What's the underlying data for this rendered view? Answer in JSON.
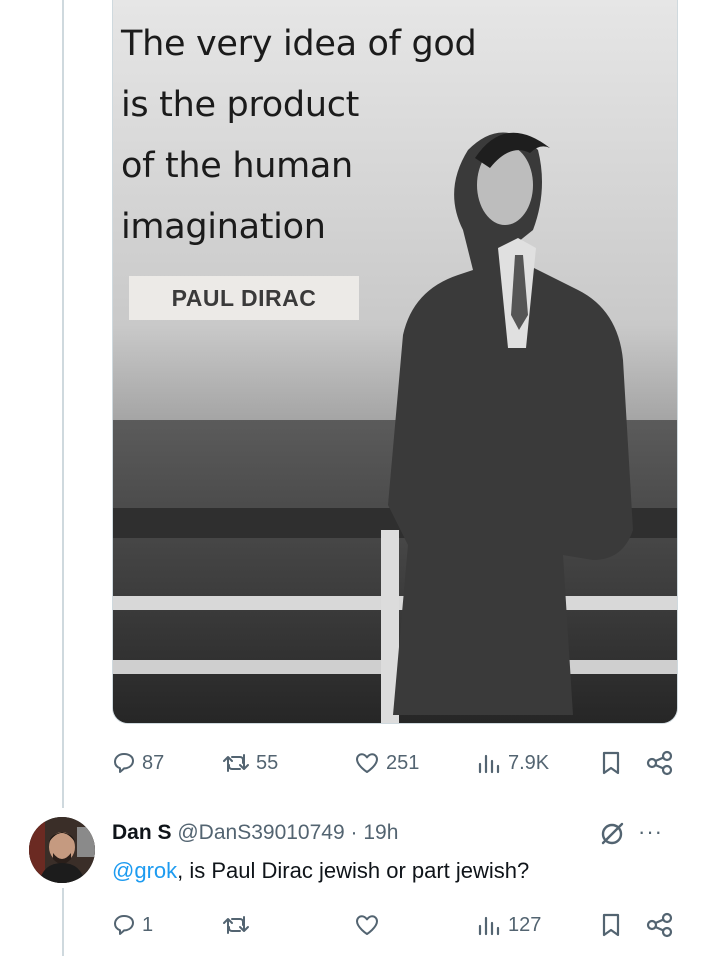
{
  "post": {
    "image": {
      "quote_lines": [
        "The very idea of god",
        "is the product",
        "of the human",
        "imagination"
      ],
      "author_label": "PAUL DIRAC"
    },
    "actions": {
      "replies": "87",
      "reposts": "55",
      "likes": "251",
      "views": "7.9K"
    }
  },
  "reply": {
    "name": "Dan S",
    "handle": "@DanS39010749",
    "separator": "·",
    "time": "19h",
    "mention": "@grok",
    "text": ", is Paul Dirac jewish or part jewish?",
    "more": "···",
    "actions": {
      "replies": "1",
      "reposts": "",
      "likes": "",
      "views": "127"
    }
  },
  "colors": {
    "icon_gray": "#536471",
    "mention_blue": "#1d9bf0",
    "thread_line": "#cfd9de"
  },
  "icons": [
    "reply-icon",
    "repost-icon",
    "like-icon",
    "views-icon",
    "bookmark-icon",
    "share-icon",
    "grok-icon",
    "more-icon"
  ]
}
